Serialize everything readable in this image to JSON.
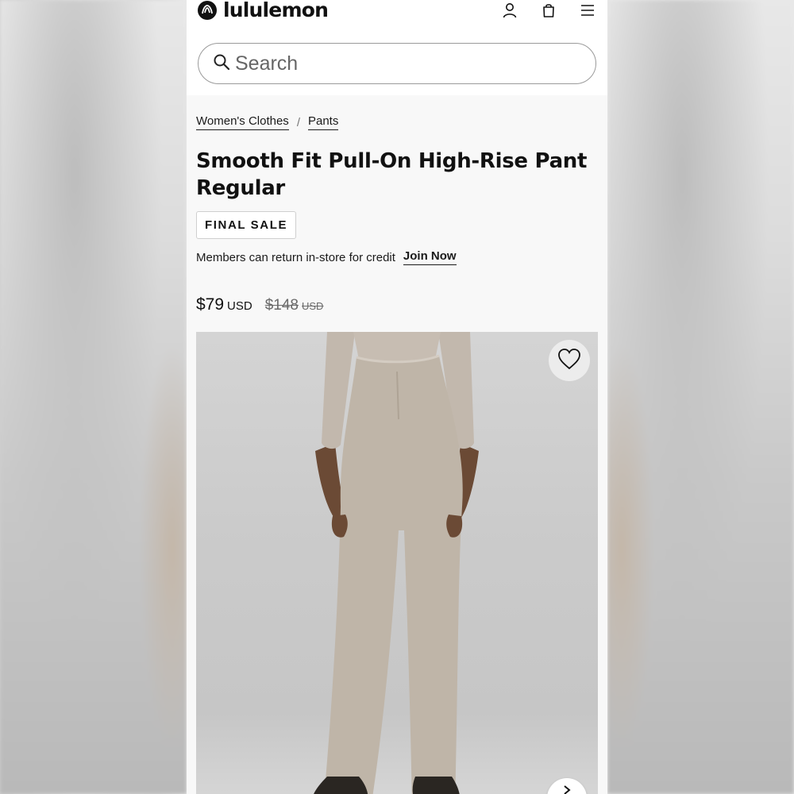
{
  "brand": {
    "name": "lululemon"
  },
  "header": {
    "icons": [
      "account-icon",
      "bag-icon",
      "menu-icon"
    ]
  },
  "search": {
    "placeholder": "Search"
  },
  "breadcrumb": {
    "items": [
      "Women's Clothes",
      "Pants"
    ],
    "separator": "/"
  },
  "product": {
    "title": "Smooth Fit Pull-On High-Rise Pant Regular",
    "badge": "FINAL SALE",
    "members_text": "Members can return in-store for credit",
    "join_label": "Join Now",
    "price_now": "$79",
    "price_now_currency": "USD",
    "price_original": "$148",
    "price_original_currency": "USD"
  },
  "gallery": {
    "image_subject": "model-wearing-beige-pants",
    "icons": [
      "heart-icon",
      "chevron-right-icon"
    ]
  },
  "colors": {
    "text": "#111111",
    "page_bg": "#f8f8f8",
    "pant_color": "#bfb5a8",
    "skin": "#6b4a35"
  }
}
